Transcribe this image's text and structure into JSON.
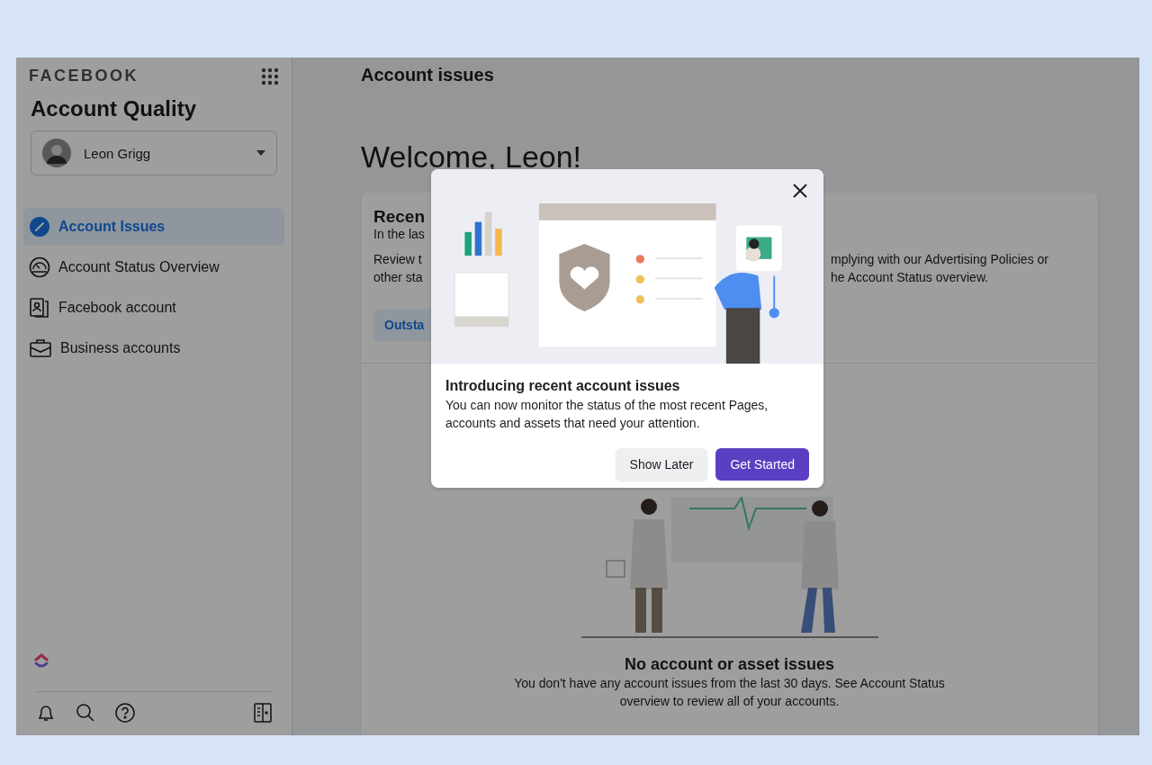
{
  "sidebar": {
    "brand": "FACEBOOK",
    "title": "Account Quality",
    "account": {
      "name": "Leon Grigg"
    },
    "nav": [
      {
        "label": "Account Issues",
        "kind": "issues",
        "selected": true
      },
      {
        "label": "Account Status Overview",
        "kind": "status",
        "selected": false
      },
      {
        "label": "Facebook account",
        "kind": "profile",
        "selected": false
      },
      {
        "label": "Business accounts",
        "kind": "business",
        "selected": false
      }
    ]
  },
  "main": {
    "title": "Account issues",
    "welcome": "Welcome, Leon!",
    "card": {
      "heading": "Recen",
      "subheading": "In the las",
      "body_rows": [
        {
          "left": "Review t",
          "right": "mplying with our Advertising Policies or"
        },
        {
          "left": "other sta",
          "right": "he Account Status overview."
        }
      ],
      "tab": "Outsta",
      "empty_title": "No account or asset issues",
      "empty_text": "You don't have any account issues from the last 30 days. See Account Status overview to review all of your accounts."
    }
  },
  "dialog": {
    "title": "Introducing recent account issues",
    "text": "You can now monitor the status of the most recent Pages, accounts and assets that need your attention.",
    "buttons": [
      {
        "label": "Show Later",
        "kind": "secondary"
      },
      {
        "label": "Get Started",
        "kind": "primary"
      }
    ]
  }
}
